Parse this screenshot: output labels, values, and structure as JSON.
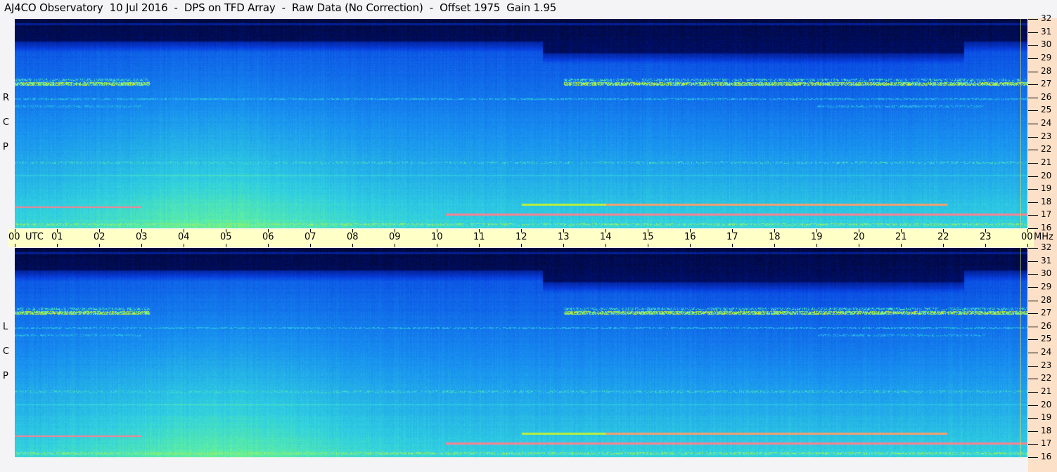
{
  "title": "AJ4CO Observatory  10 Jul 2016  -  DPS on TFD Array  -  Raw Data (No Correction)  -  Offset 1975  Gain 1.95",
  "chart_data": {
    "type": "heatmap",
    "title": "AJ4CO Observatory  10 Jul 2016  -  DPS on TFD Array  -  Raw Data (No Correction)  -  Offset 1975  Gain 1.95",
    "xlabel": "UTC",
    "ylabel": "MHz",
    "x_range": [
      0,
      24
    ],
    "y_range": [
      16,
      32
    ],
    "x_ticks": [
      "00",
      "01",
      "02",
      "03",
      "04",
      "05",
      "06",
      "07",
      "08",
      "09",
      "10",
      "11",
      "12",
      "13",
      "14",
      "15",
      "16",
      "17",
      "18",
      "19",
      "20",
      "21",
      "22",
      "23",
      "00"
    ],
    "x_unit_label": "UTC",
    "y_unit_label": "MHz",
    "y_ticks": [
      "32",
      "31",
      "30",
      "29",
      "28",
      "27",
      "26",
      "25",
      "24",
      "23",
      "22",
      "21",
      "20",
      "19",
      "18",
      "17",
      "16"
    ],
    "panels": [
      {
        "name": "RCP",
        "letters": [
          "R",
          "C",
          "P"
        ]
      },
      {
        "name": "LCP",
        "letters": [
          "L",
          "C",
          "P"
        ]
      }
    ],
    "colormap": [
      "#000000",
      "#001070",
      "#0840e0",
      "#1890f0",
      "#30d0e0",
      "#60f0a0",
      "#f0f000",
      "#ff30ff"
    ]
  }
}
